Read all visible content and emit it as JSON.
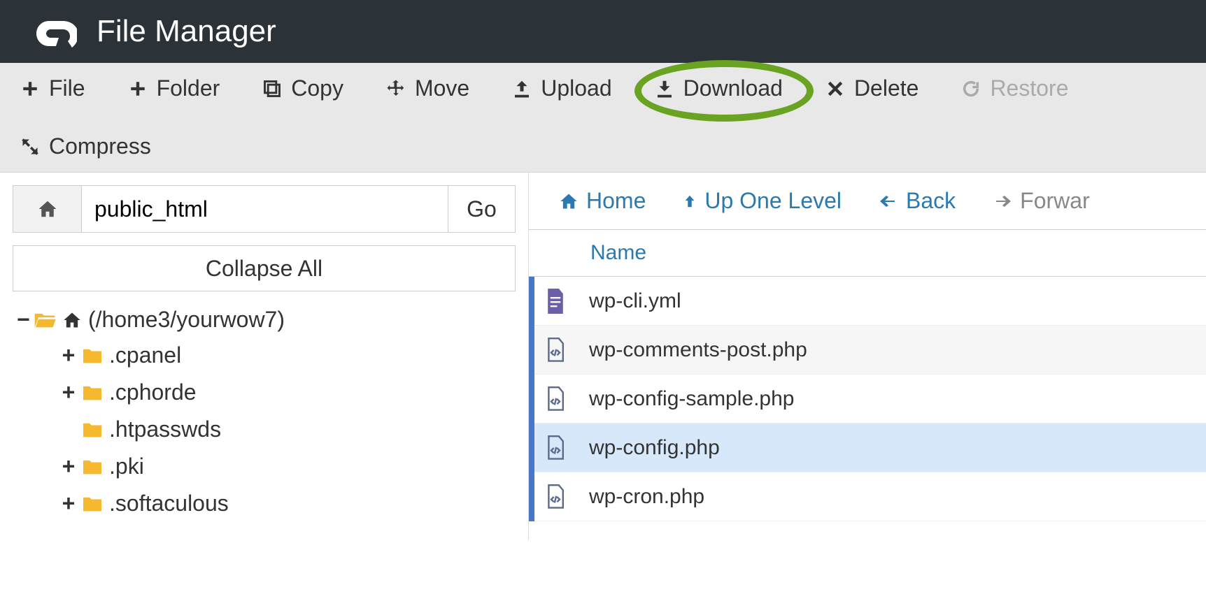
{
  "header": {
    "title": "File Manager"
  },
  "toolbar": {
    "file": "File",
    "folder": "Folder",
    "copy": "Copy",
    "move": "Move",
    "upload": "Upload",
    "download": "Download",
    "delete": "Delete",
    "restore": "Restore",
    "compress": "Compress"
  },
  "locationBar": {
    "path": "public_html",
    "go": "Go"
  },
  "collapseAll": "Collapse All",
  "tree": {
    "root": "(/home3/yourwow7)",
    "nodes": [
      {
        "expandable": true,
        "label": ".cpanel"
      },
      {
        "expandable": true,
        "label": ".cphorde"
      },
      {
        "expandable": false,
        "label": ".htpasswds"
      },
      {
        "expandable": true,
        "label": ".pki"
      },
      {
        "expandable": true,
        "label": ".softaculous"
      }
    ]
  },
  "rightNav": {
    "home": "Home",
    "upOne": "Up One Level",
    "back": "Back",
    "forward": "Forwar"
  },
  "fileTable": {
    "nameHeader": "Name",
    "rows": [
      {
        "type": "doc",
        "name": "wp-cli.yml",
        "selected": false
      },
      {
        "type": "code",
        "name": "wp-comments-post.php",
        "selected": false
      },
      {
        "type": "code",
        "name": "wp-config-sample.php",
        "selected": false
      },
      {
        "type": "code",
        "name": "wp-config.php",
        "selected": true
      },
      {
        "type": "code",
        "name": "wp-cron.php",
        "selected": false
      }
    ]
  },
  "colors": {
    "accent": "#2a7ab0",
    "highlight": "#6aa321",
    "folder": "#f5b82e",
    "folderOpen": "#f5b82e",
    "docIcon": "#6d5ea5",
    "codeIcon": "#5a6b8c"
  }
}
